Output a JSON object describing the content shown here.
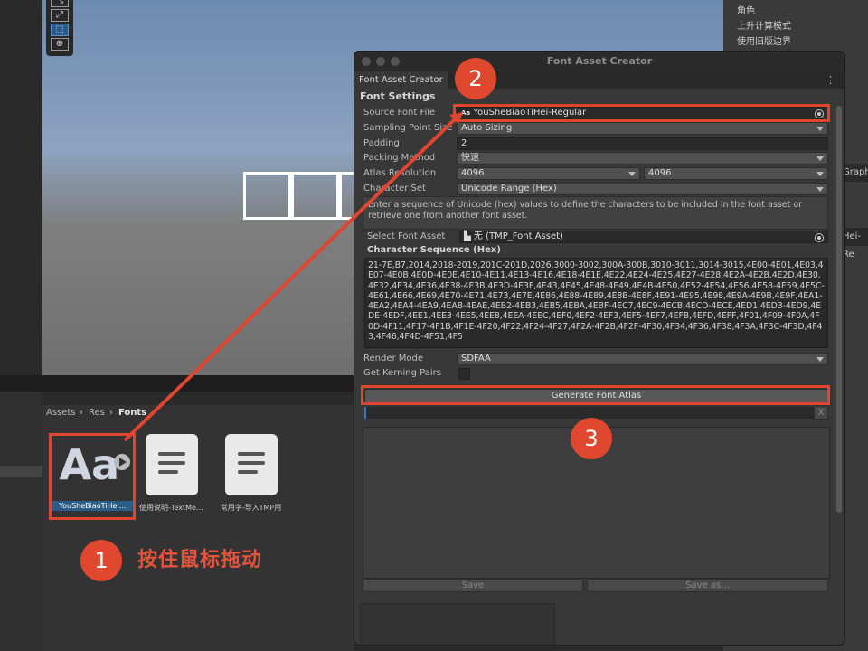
{
  "scene": {
    "tools": [
      "move",
      "scale",
      "rect",
      "transform"
    ]
  },
  "inspector": {
    "lines": [
      "角色",
      "上升计算模式",
      "使用旧版边界"
    ],
    "side_texts": [
      "Graph.",
      "Hei-Re"
    ]
  },
  "assets": {
    "breadcrumb": [
      "Assets",
      "Res",
      "Fonts"
    ],
    "items": [
      {
        "label": "YouSheBiaoTiHei…",
        "icon_text": "Aa"
      },
      {
        "label": "使用说明-TextMe…"
      },
      {
        "label": "常用字-导入TMP用"
      }
    ]
  },
  "window": {
    "title": "Font Asset Creator",
    "tab": "Font Asset Creator",
    "section": "Font Settings",
    "rows": {
      "source_font_file": {
        "label": "Source Font File",
        "icon": "Aa",
        "value": "YouSheBiaoTiHei-Regular"
      },
      "sampling_point_size": {
        "label": "Sampling Point Size",
        "value": "Auto Sizing"
      },
      "padding": {
        "label": "Padding",
        "value": "2"
      },
      "packing_method": {
        "label": "Packing Method",
        "value": "快速"
      },
      "atlas_resolution": {
        "label": "Atlas Resolution",
        "width": "4096",
        "height": "4096"
      },
      "character_set": {
        "label": "Character Set",
        "value": "Unicode Range (Hex)"
      }
    },
    "help_text": "Enter a sequence of Unicode (hex) values to define the characters to be included in the font asset or retrieve one from another font asset.",
    "select_font_asset": {
      "label": "Select Font Asset",
      "value": "无 (TMP_Font Asset)"
    },
    "character_sequence": {
      "label": "Character Sequence (Hex)",
      "value": "21-7E,B7,2014,2018-2019,201C-201D,2026,3000-3002,300A-300B,3010-3011,3014-3015,4E00-4E01,4E03,4E07-4E0B,4E0D-4E0E,4E10-4E11,4E13-4E16,4E18-4E1E,4E22,4E24-4E25,4E27-4E28,4E2A-4E2B,4E2D,4E30,4E32,4E34,4E36,4E38-4E3B,4E3D-4E3F,4E43,4E45,4E48-4E49,4E4B-4E50,4E52-4E54,4E56,4E58-4E59,4E5C-4E61,4E66,4E69,4E70-4E71,4E73,4E7E,4E86,4E88-4E89,4E8B-4E8F,4E91-4E95,4E98,4E9A-4E9B,4E9F,4EA1-4EA2,4EA4-4EA9,4EAB-4EAE,4EB2-4EB3,4EB5,4EBA,4EBF-4EC7,4EC9-4ECB,4ECD-4ECE,4ED1,4ED3-4ED9,4EDE-4EDF,4EE1,4EE3-4EE5,4EE8,4EEA-4EEC,4EF0,4EF2-4EF3,4EF5-4EF7,4EFB,4EFD,4EFF,4F01,4F09-4F0A,4F0D-4F11,4F17-4F1B,4F1E-4F20,4F22,4F24-4F27,4F2A-4F2B,4F2F-4F30,4F34,4F36,4F38,4F3A,4F3C-4F3D,4F43,4F46,4F4D-4F51,4F5"
    },
    "render_mode": {
      "label": "Render Mode",
      "value": "SDFAA"
    },
    "kerning": {
      "label": "Get Kerning Pairs"
    },
    "generate_button": "Generate Font Atlas",
    "progress_close": "X",
    "progress": 0.0,
    "save_button": "Save",
    "save_as_button": "Save as..."
  },
  "annotations": {
    "step1": "1",
    "step2": "2",
    "step3": "3",
    "hint": "按住鼠标拖动",
    "color": "#e0452f"
  }
}
